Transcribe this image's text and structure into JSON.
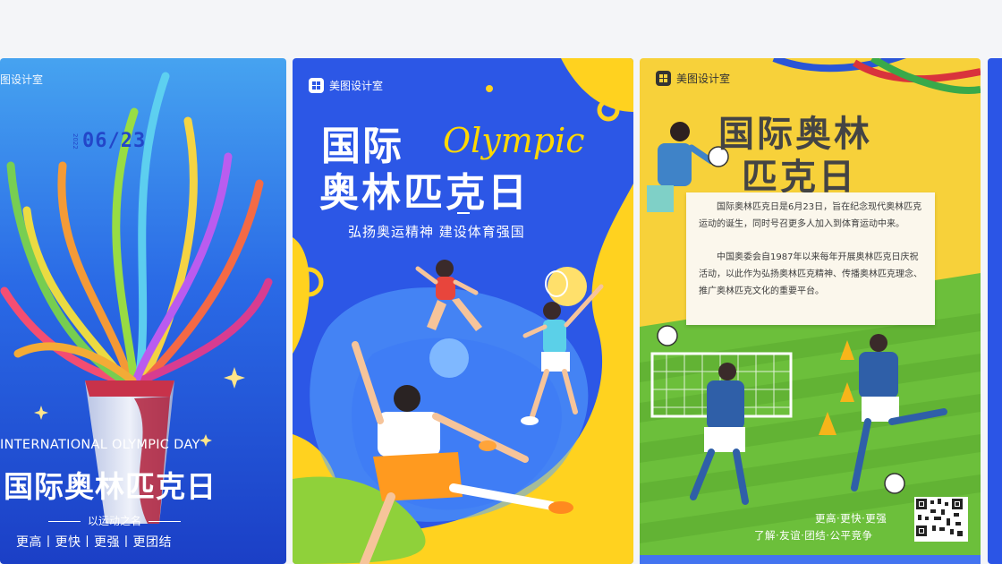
{
  "cards": [
    {
      "brand": "图设计室",
      "date": "06/23",
      "date_small": "2022",
      "title_en": "INTERNATIONAL OLYMPIC DAY",
      "title_cn": "国际奥林匹克日",
      "tagline": "以运动之名",
      "motto": "更高丨更快丨更强丨更团结"
    },
    {
      "brand": "美图设计室",
      "title_line1": "国际",
      "title_word": "Olympic",
      "title_line2": "奥林匹克日",
      "subtitle": "弘扬奥运精神  建设体育强国"
    },
    {
      "brand": "美图设计室",
      "title_line1": "国际奥林",
      "title_line2": "匹克日",
      "paragraph1": "国际奥林匹克日是6月23日，旨在纪念现代奥林匹克运动的诞生，同时号召更多人加入到体育运动中来。",
      "paragraph2": "中国奥委会自1987年以来每年开展奥林匹克日庆祝活动，以此作为弘扬奥林匹克精神、传播奥林匹克理念、推广奥林匹克文化的重要平台。",
      "slogan1": "更高·更快·更强",
      "slogan2": "了解·友谊·团结·公平竞争"
    }
  ],
  "colors": {
    "page_bg": "#f4f5f8",
    "card1_bg": "#1f4fd8",
    "card2_bg": "#2c57e6",
    "card2_accent": "#ffd800",
    "card3_bg": "#f7d13a",
    "card3_field": "#6cbf3b"
  }
}
